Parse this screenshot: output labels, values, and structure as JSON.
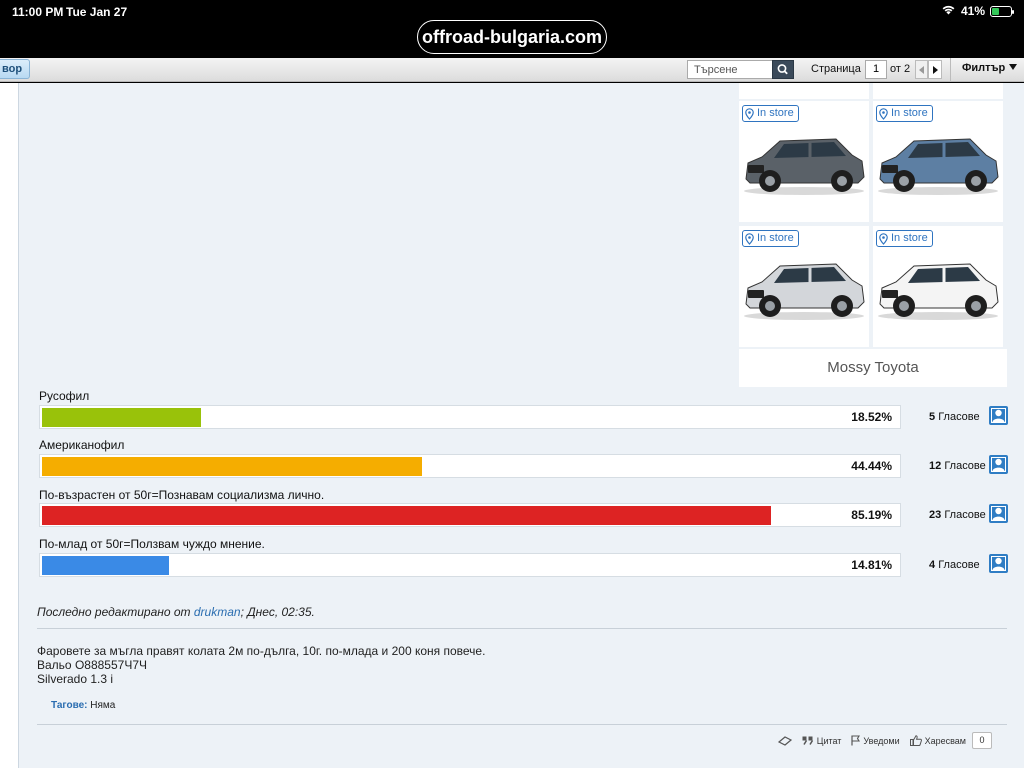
{
  "status_bar": {
    "time": "11:00 PM",
    "date": "Tue Jan 27",
    "battery": "41%",
    "battery_level": 0.41
  },
  "browser": {
    "url": "offroad-bulgaria.com"
  },
  "toolbar": {
    "reply_button": "вор",
    "search_placeholder": "Търсене",
    "page_label": "Страница",
    "page_current": "1",
    "page_of": "от 2",
    "filter_label": "Филтър"
  },
  "ad": {
    "tiles": [
      {
        "badge": "In store",
        "car_color": "#5a6168",
        "car": "grey-suv"
      },
      {
        "badge": "In store",
        "car_color": "#5d7fa3",
        "car": "blue-suv"
      },
      {
        "badge": "In store",
        "car_color": "#d3d6da",
        "car": "silver-crossover"
      },
      {
        "badge": "In store",
        "car_color": "#f4f4f4",
        "car": "white-suv"
      }
    ],
    "brand": "Mossy Toyota"
  },
  "poll": {
    "votes_word": "Гласове",
    "options": [
      {
        "label": "Русофил",
        "percent": "18.52%",
        "fraction": 0.1852,
        "votes": "5",
        "color": "#99c20a"
      },
      {
        "label": "Американофил",
        "percent": "44.44%",
        "fraction": 0.4444,
        "votes": "12",
        "color": "#f5ad00"
      },
      {
        "label": "По-възрастен от 50г=Познавам социализма лично.",
        "percent": "85.19%",
        "fraction": 0.8519,
        "votes": "23",
        "color": "#dd2323"
      },
      {
        "label": "По-млад от 50г=Ползвам чуждо мнение.",
        "percent": "14.81%",
        "fraction": 0.1481,
        "votes": "4",
        "color": "#3a8ae6"
      }
    ]
  },
  "edited": {
    "prefix": "Последно редактирано от ",
    "user": "drukman",
    "suffix": "; Днес, 02:35."
  },
  "signature": {
    "lines": [
      "Фаровете за мъгла правят колата 2м по-дълга, 10г. по-млада и 200 коня повече.",
      "Вальо О888557Ч7Ч",
      "Silverado 1.3 i"
    ]
  },
  "tags": {
    "label": "Тагове:",
    "value": " Няма"
  },
  "actions": {
    "quote": "Цитат",
    "report": "Уведоми",
    "like": "Харесвам",
    "like_count": "0"
  }
}
